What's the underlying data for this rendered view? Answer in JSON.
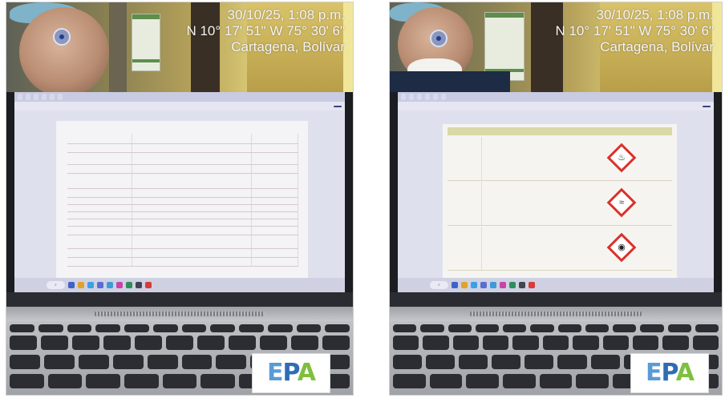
{
  "photos": [
    {
      "overlay": {
        "datetime": "30/10/25, 1:08 p.m.",
        "coords": "N 10° 17' 51\"  W 75° 30' 6\"",
        "place": "Cartagena, Bolívar"
      },
      "logo": {
        "text": "EPA"
      }
    },
    {
      "overlay": {
        "datetime": "30/10/25, 1:08 p.m.",
        "coords": "N 10° 17' 51\"  W 75° 30' 6\"",
        "place": "Cartagena, Bolívar"
      },
      "logo": {
        "text": "EPA"
      }
    }
  ],
  "colors": {
    "ghs_red": "#d9322a",
    "epa_blue": "#2e6db4",
    "epa_green": "#7fbf3f"
  }
}
